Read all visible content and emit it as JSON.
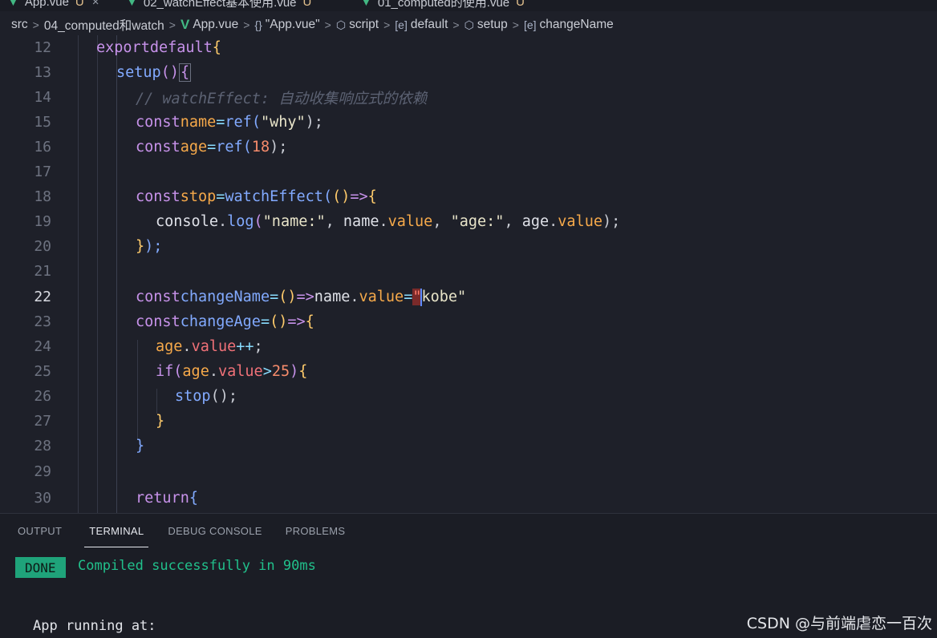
{
  "tabs": [
    {
      "label": "App.vue",
      "modified": "U",
      "close": "×"
    },
    {
      "label": "02_watchEffect基本使用.vue",
      "modified": "U"
    },
    {
      "label": "01_computed的使用.vue",
      "modified": "U"
    }
  ],
  "breadcrumb": {
    "items": [
      "src",
      "04_computed和watch",
      "App.vue",
      "\"App.vue\"",
      "script",
      "default",
      "setup",
      "changeName"
    ],
    "icons": [
      "",
      "",
      "vue-icon",
      "braces-icon",
      "cube-icon",
      "symbol-icon",
      "cube-icon",
      "symbol-icon"
    ]
  },
  "editor": {
    "active_line": 22,
    "lines": [
      {
        "n": "12"
      },
      {
        "n": "13"
      },
      {
        "n": "14"
      },
      {
        "n": "15"
      },
      {
        "n": "16"
      },
      {
        "n": "17"
      },
      {
        "n": "18"
      },
      {
        "n": "19"
      },
      {
        "n": "20"
      },
      {
        "n": "21"
      },
      {
        "n": "22"
      },
      {
        "n": "23"
      },
      {
        "n": "24"
      },
      {
        "n": "25"
      },
      {
        "n": "26"
      },
      {
        "n": "27"
      },
      {
        "n": "28"
      },
      {
        "n": "29"
      },
      {
        "n": "30"
      }
    ],
    "code": {
      "l12": [
        "export",
        "default",
        "{"
      ],
      "l13": [
        "setup",
        "()",
        "{"
      ],
      "l14": "// watchEffect: 自动收集响应式的依赖",
      "l15": [
        "const",
        "name",
        "=",
        "ref",
        "(",
        "\"why\"",
        ");"
      ],
      "l16": [
        "const",
        "age",
        "=",
        "ref",
        "(",
        "18",
        ");"
      ],
      "l18": [
        "const",
        "stop",
        "=",
        "watchEffect",
        "(",
        "()",
        "=>",
        "{"
      ],
      "l19": [
        "console",
        ".",
        "log",
        "(",
        "\"name:\"",
        ", ",
        "name",
        ".",
        "value",
        ", ",
        "\"age:\"",
        ", ",
        "age",
        ".",
        "value",
        ");"
      ],
      "l20": [
        "}",
        ");"
      ],
      "l22": [
        "const",
        "changeName",
        "=",
        "()",
        "=>",
        "name",
        ".",
        "value",
        "=",
        "\"",
        "kobe\""
      ],
      "l23": [
        "const",
        "changeAge",
        "=",
        "()",
        "=>",
        "{"
      ],
      "l24": [
        "age",
        ".",
        "value",
        "++",
        ";"
      ],
      "l25": [
        "if",
        "(",
        "age",
        ".",
        "value",
        ">",
        "25",
        ")",
        "{"
      ],
      "l26": [
        "stop",
        "();"
      ],
      "l27": "}",
      "l28": "}",
      "l30": [
        "return",
        "{"
      ]
    }
  },
  "panel": {
    "tabs": [
      "OUTPUT",
      "TERMINAL",
      "DEBUG CONSOLE",
      "PROBLEMS"
    ],
    "active_tab": "TERMINAL",
    "done_badge": "DONE",
    "compiled_msg": "Compiled successfully in 90ms",
    "running_msg": "App running at:"
  },
  "watermark": "CSDN @与前端虐恋一百次",
  "colors": {
    "keyword": "#c792ea",
    "function": "#82aaff",
    "variable": "#f6a94a",
    "property": "#f07178",
    "success": "#21c08b",
    "done_bg": "#1fa37a"
  }
}
